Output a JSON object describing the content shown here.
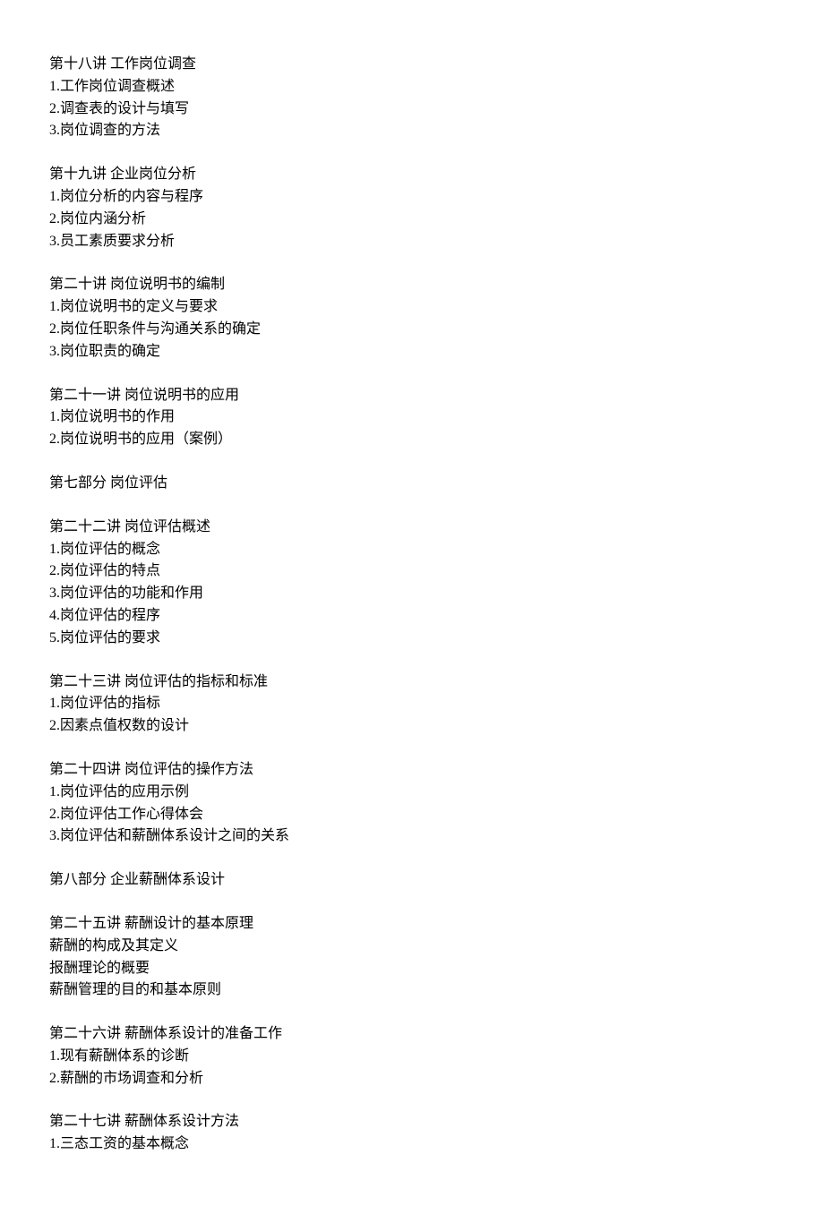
{
  "sections": [
    {
      "title": "第十八讲 工作岗位调查",
      "items": [
        "1.工作岗位调查概述",
        "2.调查表的设计与填写",
        "3.岗位调查的方法"
      ]
    },
    {
      "title": "第十九讲 企业岗位分析",
      "items": [
        "1.岗位分析的内容与程序",
        "2.岗位内涵分析",
        "3.员工素质要求分析"
      ]
    },
    {
      "title": "第二十讲 岗位说明书的编制",
      "items": [
        "1.岗位说明书的定义与要求",
        "2.岗位任职条件与沟通关系的确定",
        "3.岗位职责的确定"
      ]
    },
    {
      "title": "第二十一讲 岗位说明书的应用",
      "items": [
        "1.岗位说明书的作用",
        "2.岗位说明书的应用（案例）"
      ]
    },
    {
      "title": "第七部分 岗位评估",
      "items": []
    },
    {
      "title": "第二十二讲 岗位评估概述",
      "items": [
        "1.岗位评估的概念",
        "2.岗位评估的特点",
        "3.岗位评估的功能和作用",
        "4.岗位评估的程序",
        "5.岗位评估的要求"
      ]
    },
    {
      "title": "第二十三讲 岗位评估的指标和标准",
      "items": [
        "1.岗位评估的指标",
        "2.因素点值权数的设计"
      ]
    },
    {
      "title": "第二十四讲 岗位评估的操作方法",
      "items": [
        "1.岗位评估的应用示例",
        "2.岗位评估工作心得体会",
        "3.岗位评估和薪酬体系设计之间的关系"
      ]
    },
    {
      "title": "第八部分 企业薪酬体系设计",
      "items": []
    },
    {
      "title": "第二十五讲 薪酬设计的基本原理",
      "items": [
        "薪酬的构成及其定义",
        "报酬理论的概要",
        "薪酬管理的目的和基本原则"
      ]
    },
    {
      "title": "第二十六讲 薪酬体系设计的准备工作",
      "items": [
        "1.现有薪酬体系的诊断",
        "2.薪酬的市场调查和分析"
      ]
    },
    {
      "title": "第二十七讲 薪酬体系设计方法",
      "items": [
        "1.三态工资的基本概念"
      ]
    }
  ]
}
